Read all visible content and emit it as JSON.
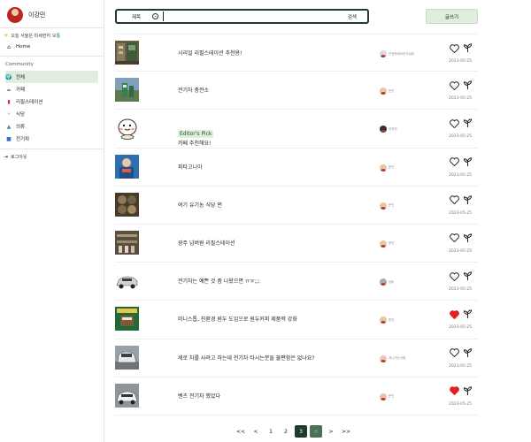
{
  "sidebar": {
    "user_name": "이강민",
    "dust": {
      "prefix": "오늘 서울은 미세먼지",
      "status": "보통"
    },
    "home_label": "Home",
    "section_title": "Community",
    "items": [
      {
        "label": "전체",
        "icon": "globe-icon"
      },
      {
        "label": "카페",
        "icon": "coffee-icon"
      },
      {
        "label": "리필스테이션",
        "icon": "refill-icon"
      },
      {
        "label": "식당",
        "icon": "restaurant-icon"
      },
      {
        "label": "의류",
        "icon": "clothing-icon"
      },
      {
        "label": "전기차",
        "icon": "car-icon"
      }
    ],
    "logout_label": "로그아웃"
  },
  "search": {
    "type_label": "제목",
    "value": "",
    "button_label": "검색"
  },
  "write_button_label": "글쓰기",
  "posts": [
    {
      "title": "시리얼 리필스테이션 추천용!",
      "author": "안녕하세요반가워요",
      "date": "2023-05-25",
      "liked": false,
      "thumb": "refill-station-photo"
    },
    {
      "title": "전기차 충전소",
      "author": "문인",
      "date": "2023-05-25",
      "liked": false,
      "thumb": "ev-charger-photo"
    },
    {
      "badge": "Editor's Pick",
      "title": "카페 추천해요!",
      "author": "관리자",
      "date": "2023-05-25",
      "liked": false,
      "thumb": "cartoon-character-image"
    },
    {
      "title": "파타고니아",
      "author": "문인",
      "date": "2023-05-25",
      "liked": false,
      "thumb": "patagonia-photo"
    },
    {
      "title": "여기 유기농 식당 찐",
      "author": "문인",
      "date": "2023-05-25",
      "liked": false,
      "thumb": "organic-food-photo"
    },
    {
      "title": "광주 넘버원 리필스테이션",
      "author": "문인",
      "date": "2023-05-25",
      "liked": false,
      "thumb": "refill-shop-photo"
    },
    {
      "title": "전기차는 예쁜 것 좀 나왔으면 ㅠㅠ;;;",
      "author": "넘버",
      "date": "2023-05-25",
      "liked": false,
      "thumb": "ev-car-photo"
    },
    {
      "title": "미니스톱, 친환경 원두 도입으로 원두커피 제품력 강화",
      "author": "문인",
      "date": "2023-05-25",
      "liked": true,
      "thumb": "coffee-ad-photo"
    },
    {
      "title": "세로 차를 사려고 하는데 전기차 타시는분들 불편함은 없나요?",
      "author": "지나가는사람",
      "date": "2023-05-25",
      "liked": false,
      "thumb": "suv-car-photo"
    },
    {
      "title": "벤츠 전기차 했었다",
      "author": "문인",
      "date": "2023-05-25",
      "liked": true,
      "thumb": "benz-car-photo"
    }
  ],
  "pagination": {
    "first": "<<",
    "prev": "<",
    "pages": [
      "1",
      "2",
      "3"
    ],
    "current": "3",
    "next": ">",
    "last": ">>"
  },
  "colors": {
    "accent": "#1e3b2b",
    "highlight": "#dfeedd",
    "like": "#e02020"
  }
}
